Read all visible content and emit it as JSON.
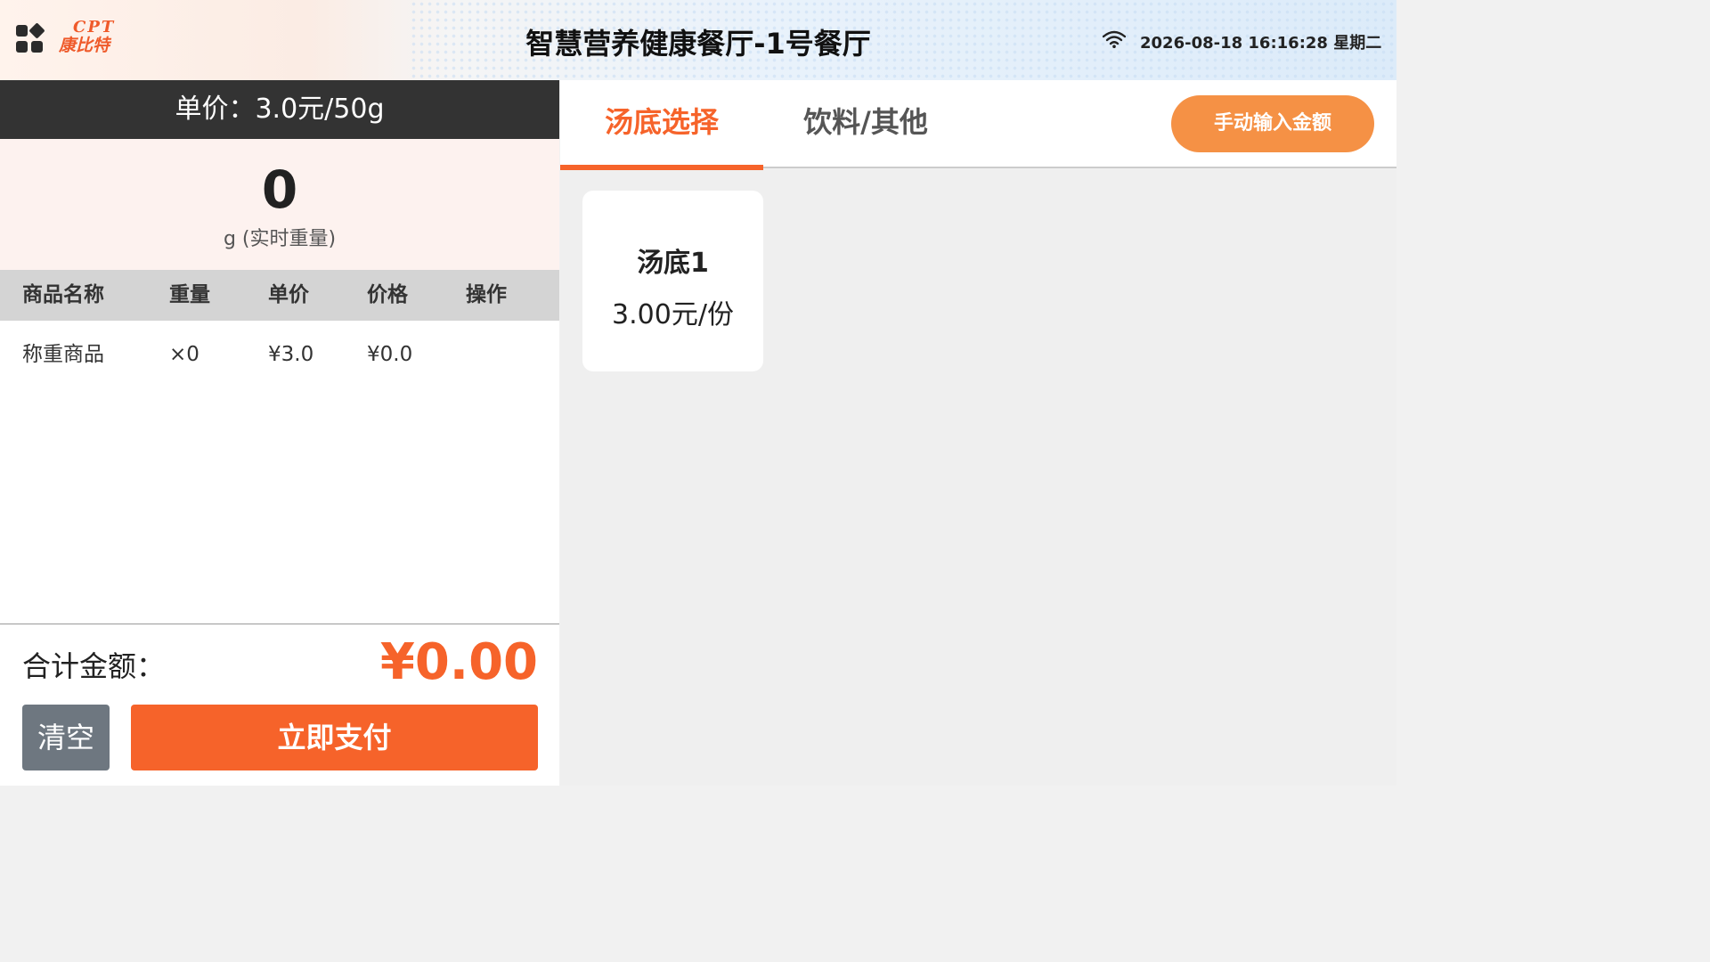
{
  "header": {
    "logo_en": "CPT",
    "logo_cn": "康比特",
    "title": "智慧营养健康餐厅-1号餐厅",
    "datetime": "2026-08-18 16:16:28 星期二",
    "icons": [
      "apps-icon",
      "wifi-icon"
    ]
  },
  "scale": {
    "unit_price_text": "单价：3.0元/50g",
    "weight_value": "0",
    "weight_unit": "g (实时重量)"
  },
  "table": {
    "headers": [
      "商品名称",
      "重量",
      "单价",
      "价格",
      "操作"
    ],
    "rows": [
      {
        "name": "称重商品",
        "weight": "×0",
        "unit_price": "¥3.0",
        "price": "¥0.0",
        "action": ""
      }
    ]
  },
  "footer": {
    "total_label": "合计金额：",
    "total_value": "¥0.00",
    "clear_label": "清空",
    "pay_label": "立即支付"
  },
  "tabs": [
    {
      "label": "汤底选择",
      "active": true
    },
    {
      "label": "饮料/其他",
      "active": false
    }
  ],
  "manual_input_label": "手动输入金额",
  "products": [
    {
      "name": "汤底1",
      "price": "3.00元/份"
    }
  ],
  "colors": {
    "accent": "#f6632a",
    "manual_button": "#f59145",
    "dark_bar": "#333333",
    "clear_button": "#6e7780"
  }
}
